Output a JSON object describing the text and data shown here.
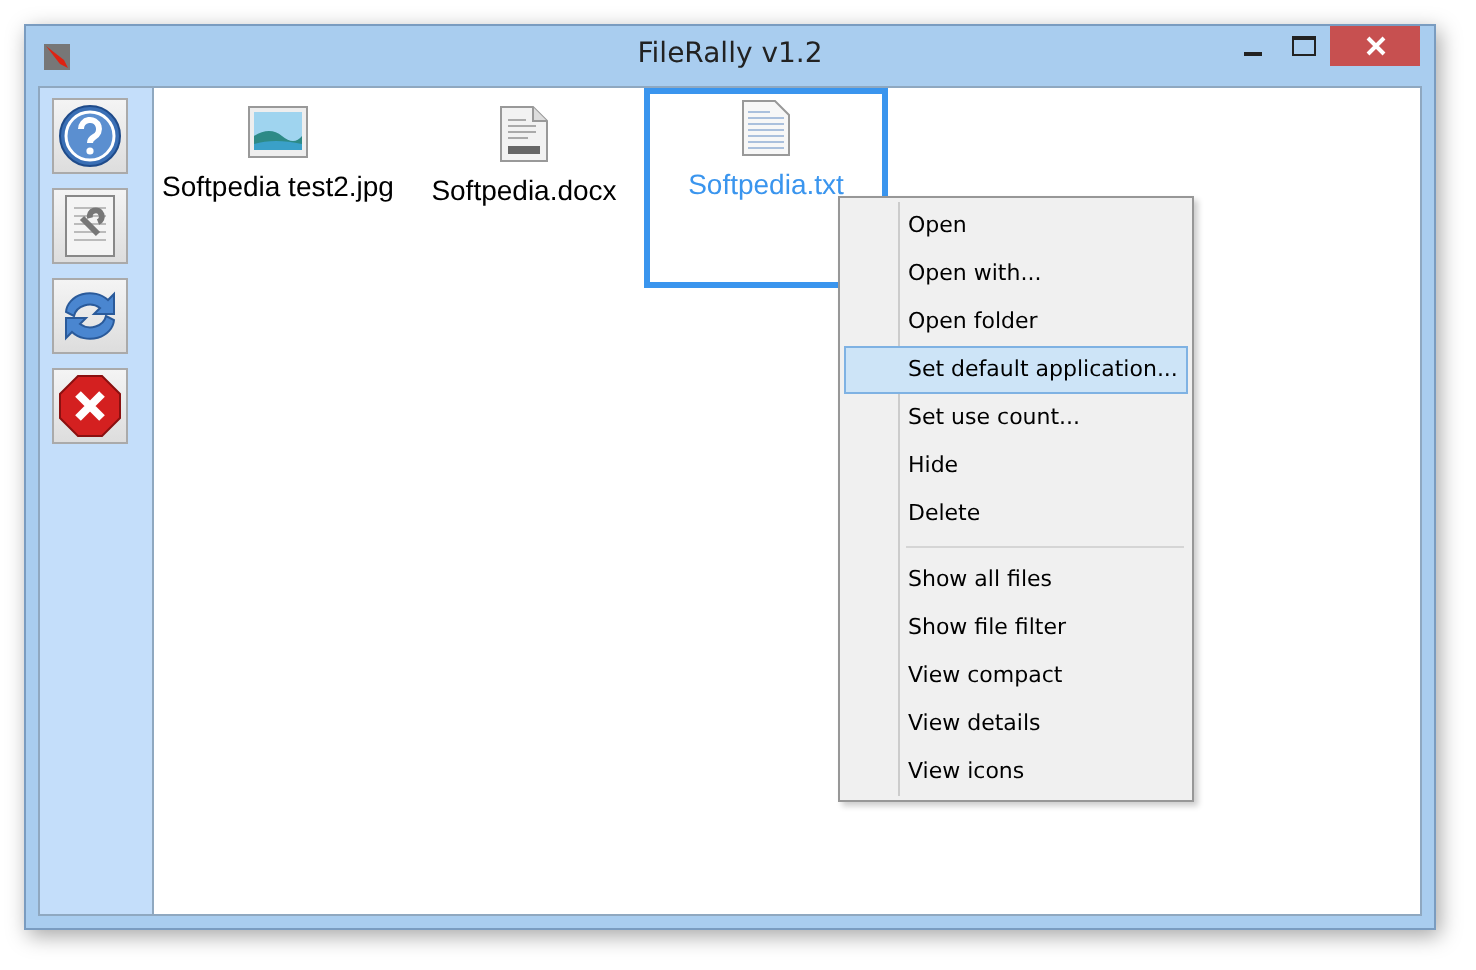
{
  "window": {
    "title": "FileRally v1.2"
  },
  "toolbar": [
    {
      "kind": "help"
    },
    {
      "kind": "document"
    },
    {
      "kind": "refresh"
    },
    {
      "kind": "stop"
    }
  ],
  "files": [
    {
      "name": "Softpedia test2.jpg",
      "kind": "image",
      "selected": false
    },
    {
      "name": "Softpedia.docx",
      "kind": "docx",
      "selected": false
    },
    {
      "name": "Softpedia.txt",
      "kind": "text",
      "selected": true
    }
  ],
  "context_menu": [
    {
      "kind": "item",
      "label": "Open",
      "selected": false
    },
    {
      "kind": "item",
      "label": "Open with...",
      "selected": false
    },
    {
      "kind": "item",
      "label": "Open folder",
      "selected": false
    },
    {
      "kind": "item",
      "label": "Set default application...",
      "selected": true
    },
    {
      "kind": "item",
      "label": "Set use count...",
      "selected": false
    },
    {
      "kind": "item",
      "label": "Hide",
      "selected": false
    },
    {
      "kind": "item",
      "label": "Delete",
      "selected": false
    },
    {
      "kind": "separator"
    },
    {
      "kind": "item",
      "label": "Show all files",
      "selected": false
    },
    {
      "kind": "item",
      "label": "Show file filter",
      "selected": false
    },
    {
      "kind": "item",
      "label": "View compact",
      "selected": false
    },
    {
      "kind": "item",
      "label": "View details",
      "selected": false
    },
    {
      "kind": "item",
      "label": "View icons",
      "selected": false
    }
  ]
}
